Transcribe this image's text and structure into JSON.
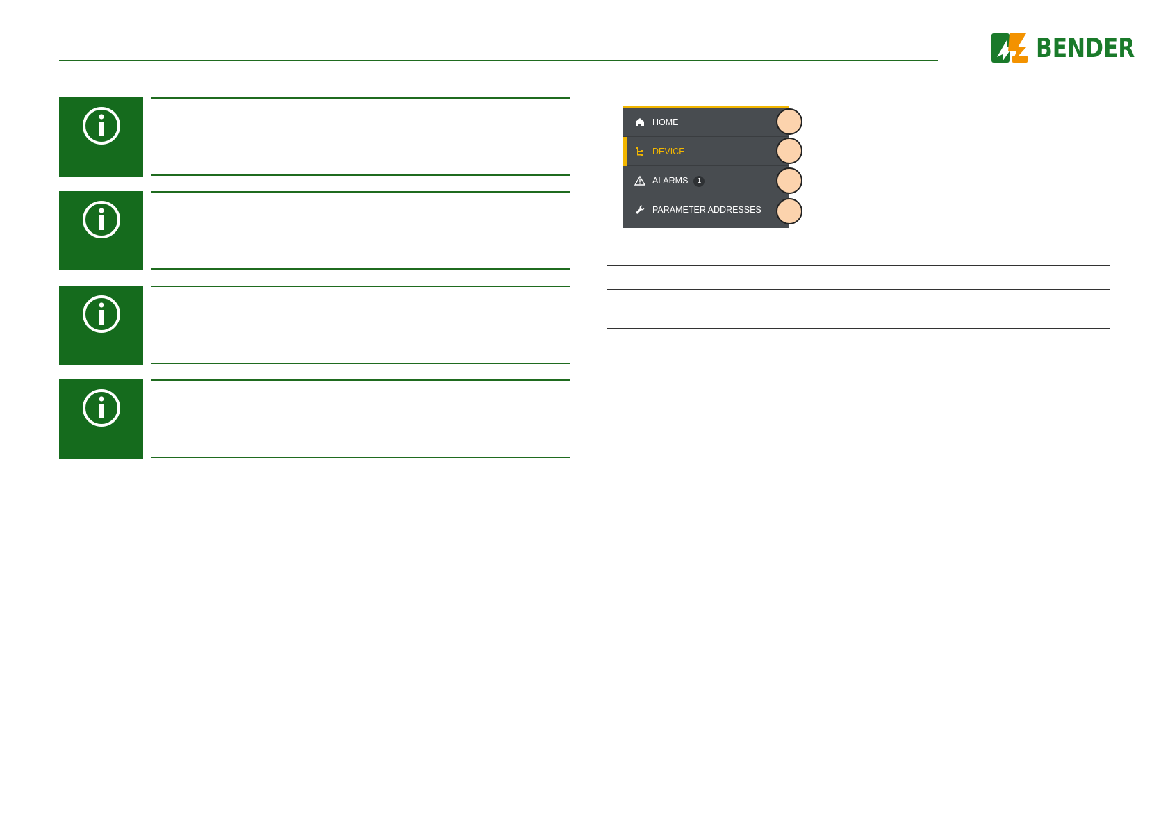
{
  "header": {
    "logo_text": "BENDER",
    "brand_green": "#1a7a2a",
    "brand_orange": "#f39200"
  },
  "notes": [
    {
      "icon": "info-icon"
    },
    {
      "icon": "info-icon"
    },
    {
      "icon": "info-icon"
    },
    {
      "icon": "info-icon"
    }
  ],
  "nav_menu": {
    "items": [
      {
        "label": "HOME",
        "icon": "home-icon",
        "active": false
      },
      {
        "label": "DEVICE",
        "icon": "device-tree-icon",
        "active": true
      },
      {
        "label": "ALARMS",
        "icon": "warning-icon",
        "badge": "1",
        "active": false
      },
      {
        "label": "PARAMETER ADDRESSES",
        "icon": "wrench-icon",
        "active": false
      }
    ],
    "background_color": "#484c50",
    "accent_color": "#f2b600"
  },
  "callout_color": "#fcd3ad"
}
